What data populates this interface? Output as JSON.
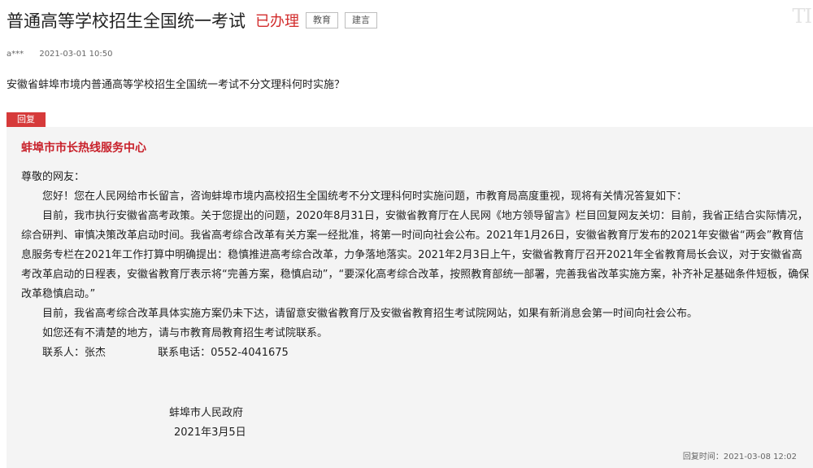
{
  "header": {
    "title": "普通高等学校招生全国统一考试",
    "status": "已办理",
    "tags": [
      "教育",
      "建言"
    ],
    "watermark": "TI"
  },
  "meta": {
    "author": "a***",
    "time": "2021-03-01 10:50"
  },
  "question": "安徽省蚌埠市境内普通高等学校招生全国统一考试不分文理科何时实施？",
  "reply": {
    "badge": "回复",
    "org": "蚌埠市市长热线服务中心",
    "greeting": "尊敬的网友：",
    "paragraphs": [
      "您好！您在人民网给市长留言，咨询蚌埠市境内高校招生全国统考不分文理科何时实施问题，市教育局高度重视，现将有关情况答复如下：",
      "目前，我市执行安徽省高考政策。关于您提出的问题，2020年8月31日，安徽省教育厅在人民网《地方领导留言》栏目回复网友关切：目前，我省正结合实际情况，综合研判、审慎决策改革启动时间。我省高考综合改革有关方案一经批准，将第一时间向社会公布。2021年1月26日，安徽省教育厅发布的2021年安徽省“两会”教育信息服务专栏在2021年工作打算中明确提出：稳慎推进高考综合改革，力争落地落实。2021年2月3日上午，安徽省教育厅召开2021年全省教育局长会议，对于安徽省高考改革启动的日程表，安徽省教育厅表示将“完善方案，稳慎启动”，“要深化高考综合改革，按照教育部统一部署，完善我省改革实施方案，补齐补足基础条件短板，确保改革稳慎启动。”",
      "目前，我省高考综合改革具体实施方案仍未下达，请留意安徽省教育厅及安徽省教育招生考试院网站，如果有新消息会第一时间向社会公布。",
      "如您还有不清楚的地方，请与市教育局教育招生考试院联系。"
    ],
    "contact_person": "联系人：张杰",
    "contact_phone": "联系电话：0552-4041675",
    "signature": "蚌埠市人民政府",
    "sign_date": "2021年3月5日",
    "reply_time": "回复时间：2021-03-08 12:02"
  }
}
